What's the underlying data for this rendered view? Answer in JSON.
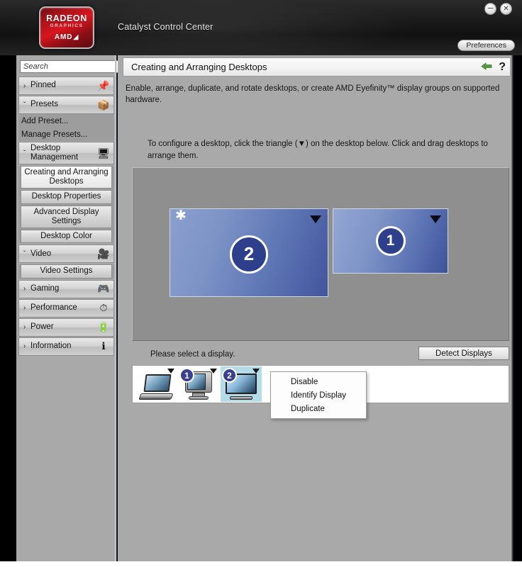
{
  "window": {
    "app_title": "Catalyst Control Center",
    "logo": {
      "brand": "RADEON",
      "sub": "GRAPHICS",
      "vendor": "AMD",
      "vendor_arrow": "◢"
    },
    "minimize_label": "–",
    "close_label": "✕",
    "preferences_label": "Preferences"
  },
  "sidebar": {
    "search": {
      "value": "Search",
      "placeholder": "Search",
      "icon": "search-icon"
    },
    "collapse_label": "«",
    "groups": [
      {
        "label": "Pinned",
        "chevron": "›",
        "icon": "pin-icon",
        "icon_glyph": "📌",
        "expanded": false,
        "items": []
      },
      {
        "label": "Presets",
        "chevron": "ˇ",
        "icon": "presets-icon",
        "icon_glyph": "📦",
        "expanded": true,
        "items": [
          {
            "label": "Add Preset...",
            "style": "plain",
            "selected": false
          },
          {
            "label": "Manage Presets...",
            "style": "plain",
            "selected": false
          }
        ]
      },
      {
        "label": "Desktop Management",
        "chevron": "ˇ",
        "icon": "desktop-management-icon",
        "icon_glyph": "🖥",
        "expanded": true,
        "items": [
          {
            "label": "Creating and Arranging Desktops",
            "style": "button",
            "selected": true
          },
          {
            "label": "Desktop Properties",
            "style": "button",
            "selected": false
          },
          {
            "label": "Advanced Display Settings",
            "style": "button",
            "selected": false
          },
          {
            "label": "Desktop Color",
            "style": "button",
            "selected": false
          }
        ]
      },
      {
        "label": "Video",
        "chevron": "ˇ",
        "icon": "video-icon",
        "icon_glyph": "🎥",
        "expanded": true,
        "items": [
          {
            "label": "Video Settings",
            "style": "button",
            "selected": false
          }
        ]
      },
      {
        "label": "Gaming",
        "chevron": "›",
        "icon": "gaming-icon",
        "icon_glyph": "🎮",
        "expanded": false,
        "items": []
      },
      {
        "label": "Performance",
        "chevron": "›",
        "icon": "performance-icon",
        "icon_glyph": "⏱",
        "expanded": false,
        "items": []
      },
      {
        "label": "Power",
        "chevron": "›",
        "icon": "power-icon",
        "icon_glyph": "🔋",
        "expanded": false,
        "items": []
      },
      {
        "label": "Information",
        "chevron": "›",
        "icon": "information-icon",
        "icon_glyph": "ℹ",
        "expanded": false,
        "items": []
      }
    ]
  },
  "main": {
    "page_title": "Creating and Arranging Desktops",
    "back_icon": "back-arrow-icon",
    "back_glyph": "➤",
    "help_label": "?",
    "description": "Enable, arrange, duplicate, and rotate desktops, or create AMD Eyefinity™ display groups on supported hardware.",
    "instruction": "To configure a desktop, click the triangle (▼) on the desktop below.  Click and drag desktops to arrange them.",
    "desktops": [
      {
        "number": "2",
        "primary": true,
        "primary_marker": "✱",
        "triangle": "▼"
      },
      {
        "number": "1",
        "primary": false,
        "primary_marker": "",
        "triangle": "▼"
      }
    ],
    "select_message": "Please select a display.",
    "detect_button": "Detect Displays",
    "display_icons": [
      {
        "kind": "laptop",
        "badge": "",
        "selected": false,
        "triangle": "▼"
      },
      {
        "kind": "crt-monitor",
        "badge": "1",
        "selected": false,
        "triangle": "▼"
      },
      {
        "kind": "flat-panel",
        "badge": "2",
        "selected": true,
        "triangle": "▼"
      }
    ],
    "context_menu": {
      "items": [
        {
          "label": "Disable"
        },
        {
          "label": "Identify Display"
        },
        {
          "label": "Duplicate"
        }
      ]
    }
  },
  "colors": {
    "accent_red": "#c8131c",
    "panel_gray": "#a9a9a9",
    "canvas_gray": "#8f8f8f",
    "desktop_blue": "#5f78b6",
    "badge_navy": "#2e3f8c",
    "selection_cyan": "#b3dce8"
  }
}
